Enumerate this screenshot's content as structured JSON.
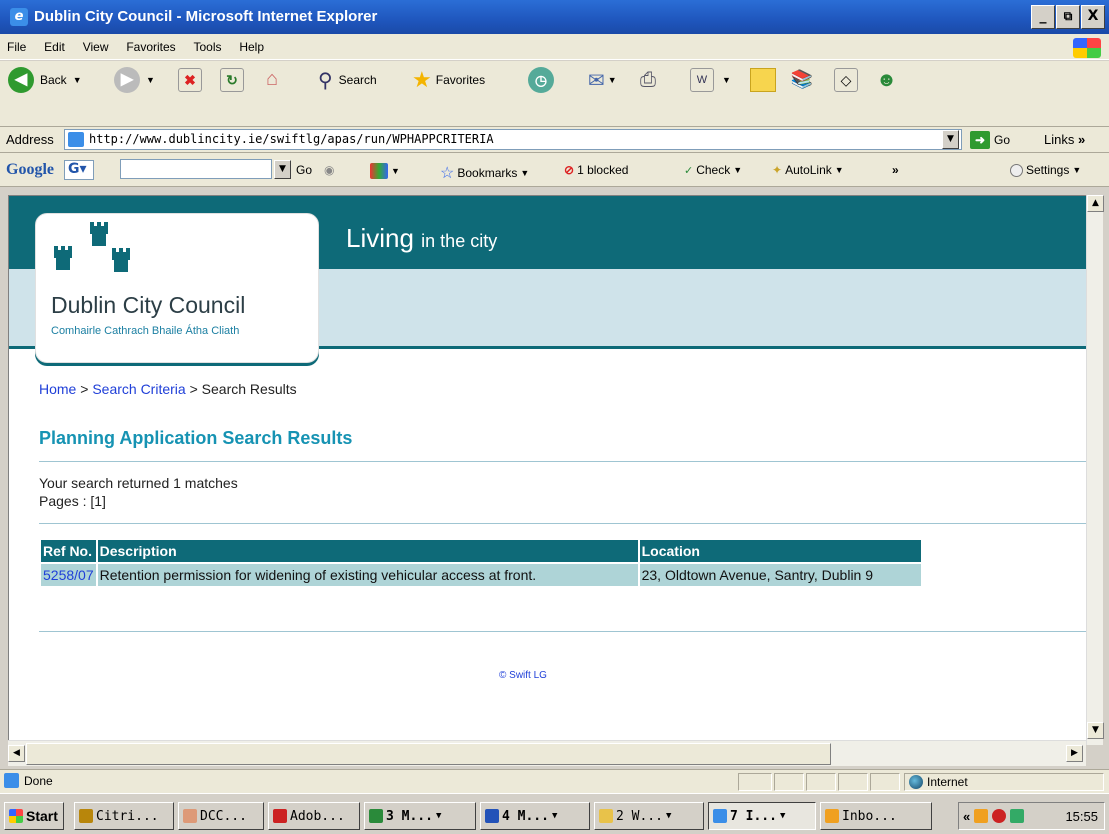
{
  "window": {
    "title": "Dublin City Council - Microsoft Internet Explorer",
    "minimize": "_",
    "restore": "&#9633;",
    "close": "X"
  },
  "menu": [
    "File",
    "Edit",
    "View",
    "Favorites",
    "Tools",
    "Help"
  ],
  "toolbar": {
    "back": "Back",
    "search": "Search",
    "favorites": "Favorites"
  },
  "address": {
    "label": "Address",
    "url": "http://www.dublincity.ie/swiftlg/apas/run/WPHAPPCRITERIA",
    "go": "Go",
    "links": "Links"
  },
  "googlebar": {
    "logo": "Google",
    "go": "Go",
    "bookmarks": "Bookmarks",
    "blocked": "1 blocked",
    "check": "Check",
    "autolink": "AutoLink",
    "settings": "Settings"
  },
  "page": {
    "banner_main": "Living",
    "banner_sub": "in the city",
    "logo_name": "Dublin City Council",
    "logo_irish": "Comhairle Cathrach Bhaile Átha Cliath",
    "breadcrumb": {
      "home": "Home",
      "sep1": " > ",
      "criteria": "Search Criteria",
      "sep2": " > ",
      "current": "Search Results"
    },
    "title": "Planning Application Search Results",
    "summary_line1": "Your search returned 1 matches",
    "summary_line2": "Pages : [1]",
    "table": {
      "headers": [
        "Ref No.",
        "Description",
        "Location"
      ],
      "rows": [
        [
          "5258/07",
          "Retention permission for widening of existing vehicular access at front.",
          "23, Oldtown Avenue, Santry, Dublin 9"
        ]
      ]
    },
    "footer": "© Swift LG"
  },
  "status": {
    "text": "Done",
    "zone": "Internet"
  },
  "taskbar": {
    "start": "Start",
    "tasks": [
      "Citri...",
      "DCC...",
      "Adob...",
      "3 M...",
      "4 M...",
      "2 W...",
      "7 I...",
      "Inbo..."
    ],
    "clock": "15:55"
  }
}
